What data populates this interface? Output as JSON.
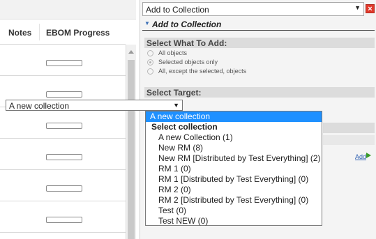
{
  "grid": {
    "columns": [
      "Notes",
      "EBOM Progress"
    ],
    "rows": [
      {
        "progress": 0
      },
      {
        "progress": 0
      },
      {
        "progress": 0
      },
      {
        "progress": 0
      },
      {
        "progress": 0
      },
      {
        "progress": 0
      }
    ]
  },
  "panel": {
    "top_select_value": "Add to Collection",
    "close_icon": "close-x-icon",
    "title": "Add to Collection",
    "select_what": {
      "header": "Select What To Add:",
      "options": [
        "All objects",
        "Selected objects only",
        "All, except the selected, objects"
      ],
      "selected_index": 1
    },
    "select_target": {
      "header": "Select Target:",
      "value": "A new collection"
    },
    "add_link": "Add"
  },
  "dropdown": {
    "highlighted": "A new collection",
    "group_label": "Select collection",
    "options": [
      "A new Collection (1)",
      "New RM (8)",
      "New RM [Distributed by Test Everything] (2)",
      "RM 1 (0)",
      "RM 1 [Distributed by Test Everything] (0)",
      "RM 2 (0)",
      "RM 2 [Distributed by Test Everything] (0)",
      "Test (0)",
      "Test NEW (0)"
    ]
  },
  "colors": {
    "highlight": "#1e90ff",
    "close": "#e0392b",
    "link": "#2a5db0",
    "add_arrow": "#3a9a2a"
  }
}
